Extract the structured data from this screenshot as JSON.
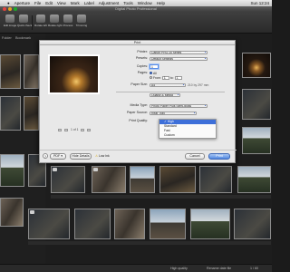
{
  "menubar": {
    "apple": "",
    "items": [
      "Aperture",
      "File",
      "Edit",
      "View",
      "Mark",
      "Label",
      "Adjustment",
      "Tools",
      "Window",
      "Help"
    ],
    "right": "Sun 12:24"
  },
  "window": {
    "title": "Digital Photo Professional"
  },
  "toolbar": {
    "buttons": [
      {
        "label": "Edit image",
        "icon": "edit-image-icon"
      },
      {
        "label": "Quick check",
        "icon": "quick-check-icon"
      },
      {
        "label": "Rotate left",
        "icon": "rotate-left-icon"
      },
      {
        "label": "Rotate right",
        "icon": "rotate-right-icon"
      },
      {
        "label": "Process",
        "icon": "process-icon"
      },
      {
        "label": "Trimming",
        "icon": "trimming-icon"
      }
    ]
  },
  "tabs": {
    "left": "Folder",
    "right": "Bookmark"
  },
  "print_dialog": {
    "title": "Print",
    "printer_label": "Printer:",
    "printer_value": "Canon PRO-10 series",
    "presets_label": "Presets:",
    "presets_value": "Default Settings",
    "copies_label": "Copies:",
    "copies_value": "1",
    "pages_label": "Pages:",
    "pages_all": "All",
    "pages_from": "From:",
    "from_value": "1",
    "to_label": "to:",
    "to_value": "1",
    "paper_size_label": "Paper Size:",
    "paper_size_value": "A4",
    "paper_size_dims": "210 by 297 mm",
    "section_label": "Quality & Media",
    "media_type_label": "Media Type:",
    "media_type_value": "Photo Paper Plus Semi-gloss",
    "paper_source_label": "Paper Source:",
    "paper_source_value": "Rear Tray",
    "print_quality_label": "Print Quality:",
    "quality_options": [
      "High",
      "Standard",
      "Fast",
      "Custom"
    ],
    "quality_selected": "High",
    "page_indicator": "1 of 1",
    "pdf_label": "PDF",
    "hide_details": "Hide Details",
    "low_ink": "Low Ink",
    "cancel": "Cancel",
    "print": "Print",
    "help": "?"
  },
  "status": {
    "quality": "High quality",
    "selection": "Rename date file",
    "count": "1 / 60"
  }
}
